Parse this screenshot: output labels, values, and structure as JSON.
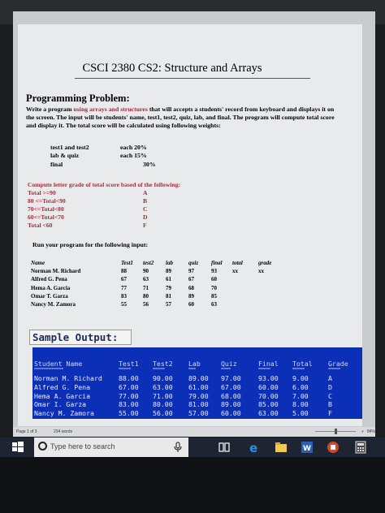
{
  "document": {
    "title": "CSCI 2380  CS2: Structure and Arrays",
    "section_heading": "Programming Problem:",
    "paragraph_parts": [
      "Write a program ",
      "using arrays and structures",
      " that will accepts a students' record from keyboard and displays it on the screen. The input will be students' name, test1, test2, quiz, lab, and final. The program will compute total score and display it. The total score will be calculated using following weights:"
    ],
    "weights": [
      {
        "item": "test1 and test2",
        "weight": "each 20%"
      },
      {
        "item": "lab & quiz",
        "weight": "each 15%"
      },
      {
        "item": "final",
        "weight": "30%"
      }
    ],
    "grade_heading": "Compute letter grade of total score based of the following:",
    "grade_rules": [
      {
        "rule": "Total   >=90",
        "letter": "A"
      },
      {
        "rule": "80 <=Total<90",
        "letter": "B"
      },
      {
        "rule": "70<=Total<80",
        "letter": "C"
      },
      {
        "rule": "60<=Total<70",
        "letter": "D"
      },
      {
        "rule": "Total <60",
        "letter": "F"
      }
    ],
    "run_instruction": "Run your program for the following input:",
    "input_table": {
      "headers": [
        "Name",
        "Test1",
        "test2",
        "lab",
        "quiz",
        "final",
        "total",
        "grade"
      ],
      "rows": [
        [
          "Norman M. Richard",
          "88",
          "90",
          "89",
          "97",
          "93",
          "xx",
          "xx"
        ],
        [
          "Alfred G. Pena",
          "67",
          "63",
          "61",
          "67",
          "60",
          "",
          ""
        ],
        [
          "Hema A. Garcia",
          "77",
          "71",
          "79",
          "68",
          "70",
          "",
          ""
        ],
        [
          "Omar T. Garza",
          "83",
          "80",
          "81",
          "89",
          "85",
          "",
          ""
        ],
        [
          "Nancy M. Zamora",
          "55",
          "56",
          "57",
          "60",
          "63",
          "",
          ""
        ]
      ]
    },
    "sample_output_label": "Sample Output:",
    "output_table": {
      "headers": [
        "Student Name",
        "Test1",
        "Test2",
        "Lab",
        "Quiz",
        "Final",
        "Total",
        "Grade"
      ],
      "underline": [
        "============",
        "=====",
        "=====",
        "===",
        "====",
        "=====",
        "=====",
        "====="
      ],
      "rows": [
        [
          "Norman M. Richard",
          "88.00",
          "90.00",
          "89.00",
          "97.00",
          "93.00",
          "9.00",
          "A"
        ],
        [
          "Alfred G. Pena",
          "67.00",
          "63.00",
          "61.00",
          "67.00",
          "60.00",
          "6.00",
          "D"
        ],
        [
          "Hema A. Garcia",
          "77.00",
          "71.00",
          "79.00",
          "68.00",
          "70.00",
          "7.00",
          "C"
        ],
        [
          "Omar I. Garza",
          "83.00",
          "80.00",
          "81.00",
          "89.00",
          "85.00",
          "8.00",
          "B"
        ],
        [
          "Nancy M. Zamora",
          "55.00",
          "56.00",
          "57.00",
          "60.00",
          "63.00",
          "5.00",
          "F"
        ]
      ]
    }
  },
  "status_bar": {
    "page": "Page 1 of 3",
    "words": "234 words",
    "zoom": "84%",
    "zoom_plus": "+"
  },
  "taskbar": {
    "search_placeholder": "Type here to search"
  },
  "colors": {
    "output_background": "#0c2fb8",
    "highlight_red": "#b22a35"
  }
}
